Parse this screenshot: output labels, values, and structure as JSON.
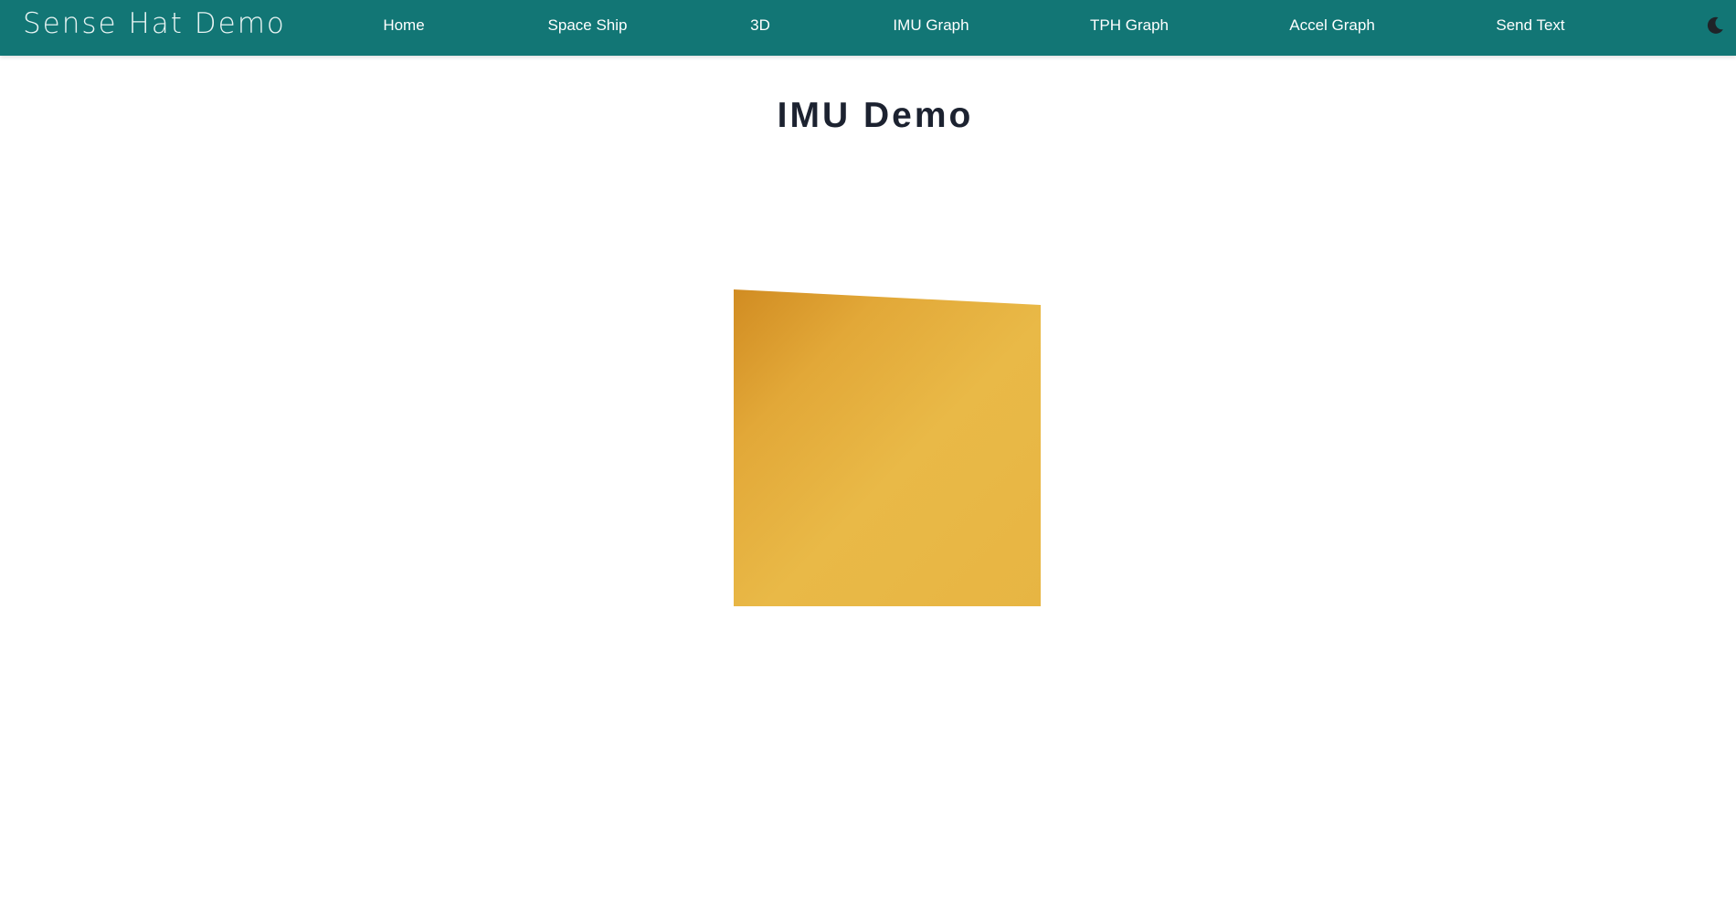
{
  "navbar": {
    "brand": "Sense Hat Demo",
    "items": [
      {
        "label": "Home"
      },
      {
        "label": "Space Ship"
      },
      {
        "label": "3D"
      },
      {
        "label": "IMU Graph"
      },
      {
        "label": "TPH Graph"
      },
      {
        "label": "Accel Graph"
      },
      {
        "label": "Send Text"
      }
    ],
    "theme_toggle_icon": "moon-icon",
    "background_color": "#127675"
  },
  "main": {
    "title": "IMU Demo",
    "board_color": "#e8b540",
    "board_edge_color": "#d18c22"
  }
}
